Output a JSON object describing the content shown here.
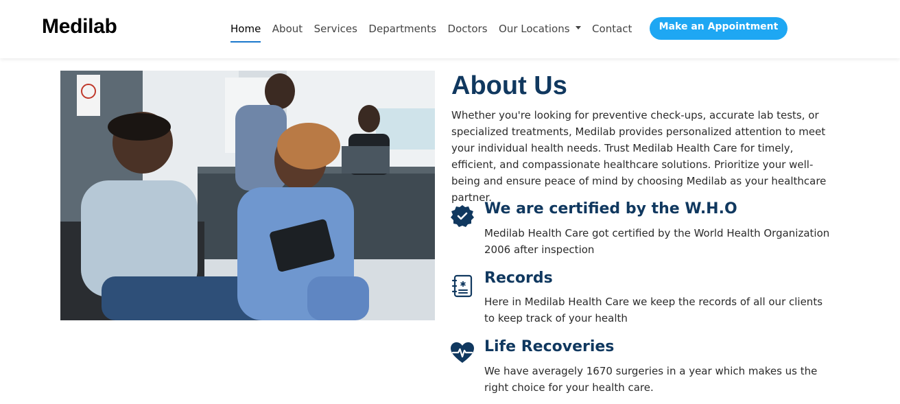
{
  "header": {
    "logo": "Medilab",
    "nav": [
      "Home",
      "About",
      "Services",
      "Departments",
      "Doctors",
      "Our Locations",
      "Contact"
    ],
    "cta": "Make an Appointment"
  },
  "about": {
    "title": "About Us",
    "intro": "Whether you're looking for preventive check-ups, accurate lab tests, or specialized treatments, Medilab provides personalized attention to meet your individual health needs. Trust Medilab Health Care for timely, efficient, and compassionate healthcare solutions. Prioritize your well-being and ensure peace of mind by choosing Medilab as your healthcare partner."
  },
  "features": [
    {
      "icon": "certified-badge-icon",
      "title": "We are certified by the W.H.O",
      "text": "Medilab Health Care got certified by the World Health Organization 2006 after inspection"
    },
    {
      "icon": "records-icon",
      "title": "Records",
      "text": "Here in Medilab Health Care we keep the records of all our clients to keep track of your health"
    },
    {
      "icon": "heart-pulse-icon",
      "title": "Life Recoveries",
      "text": "We have averagely 1670 surgeries in a year which makes us the right choice for your health care."
    }
  ],
  "colors": {
    "accent": "#1977cc",
    "button": "#1ea7f3",
    "heading": "#10385f"
  }
}
